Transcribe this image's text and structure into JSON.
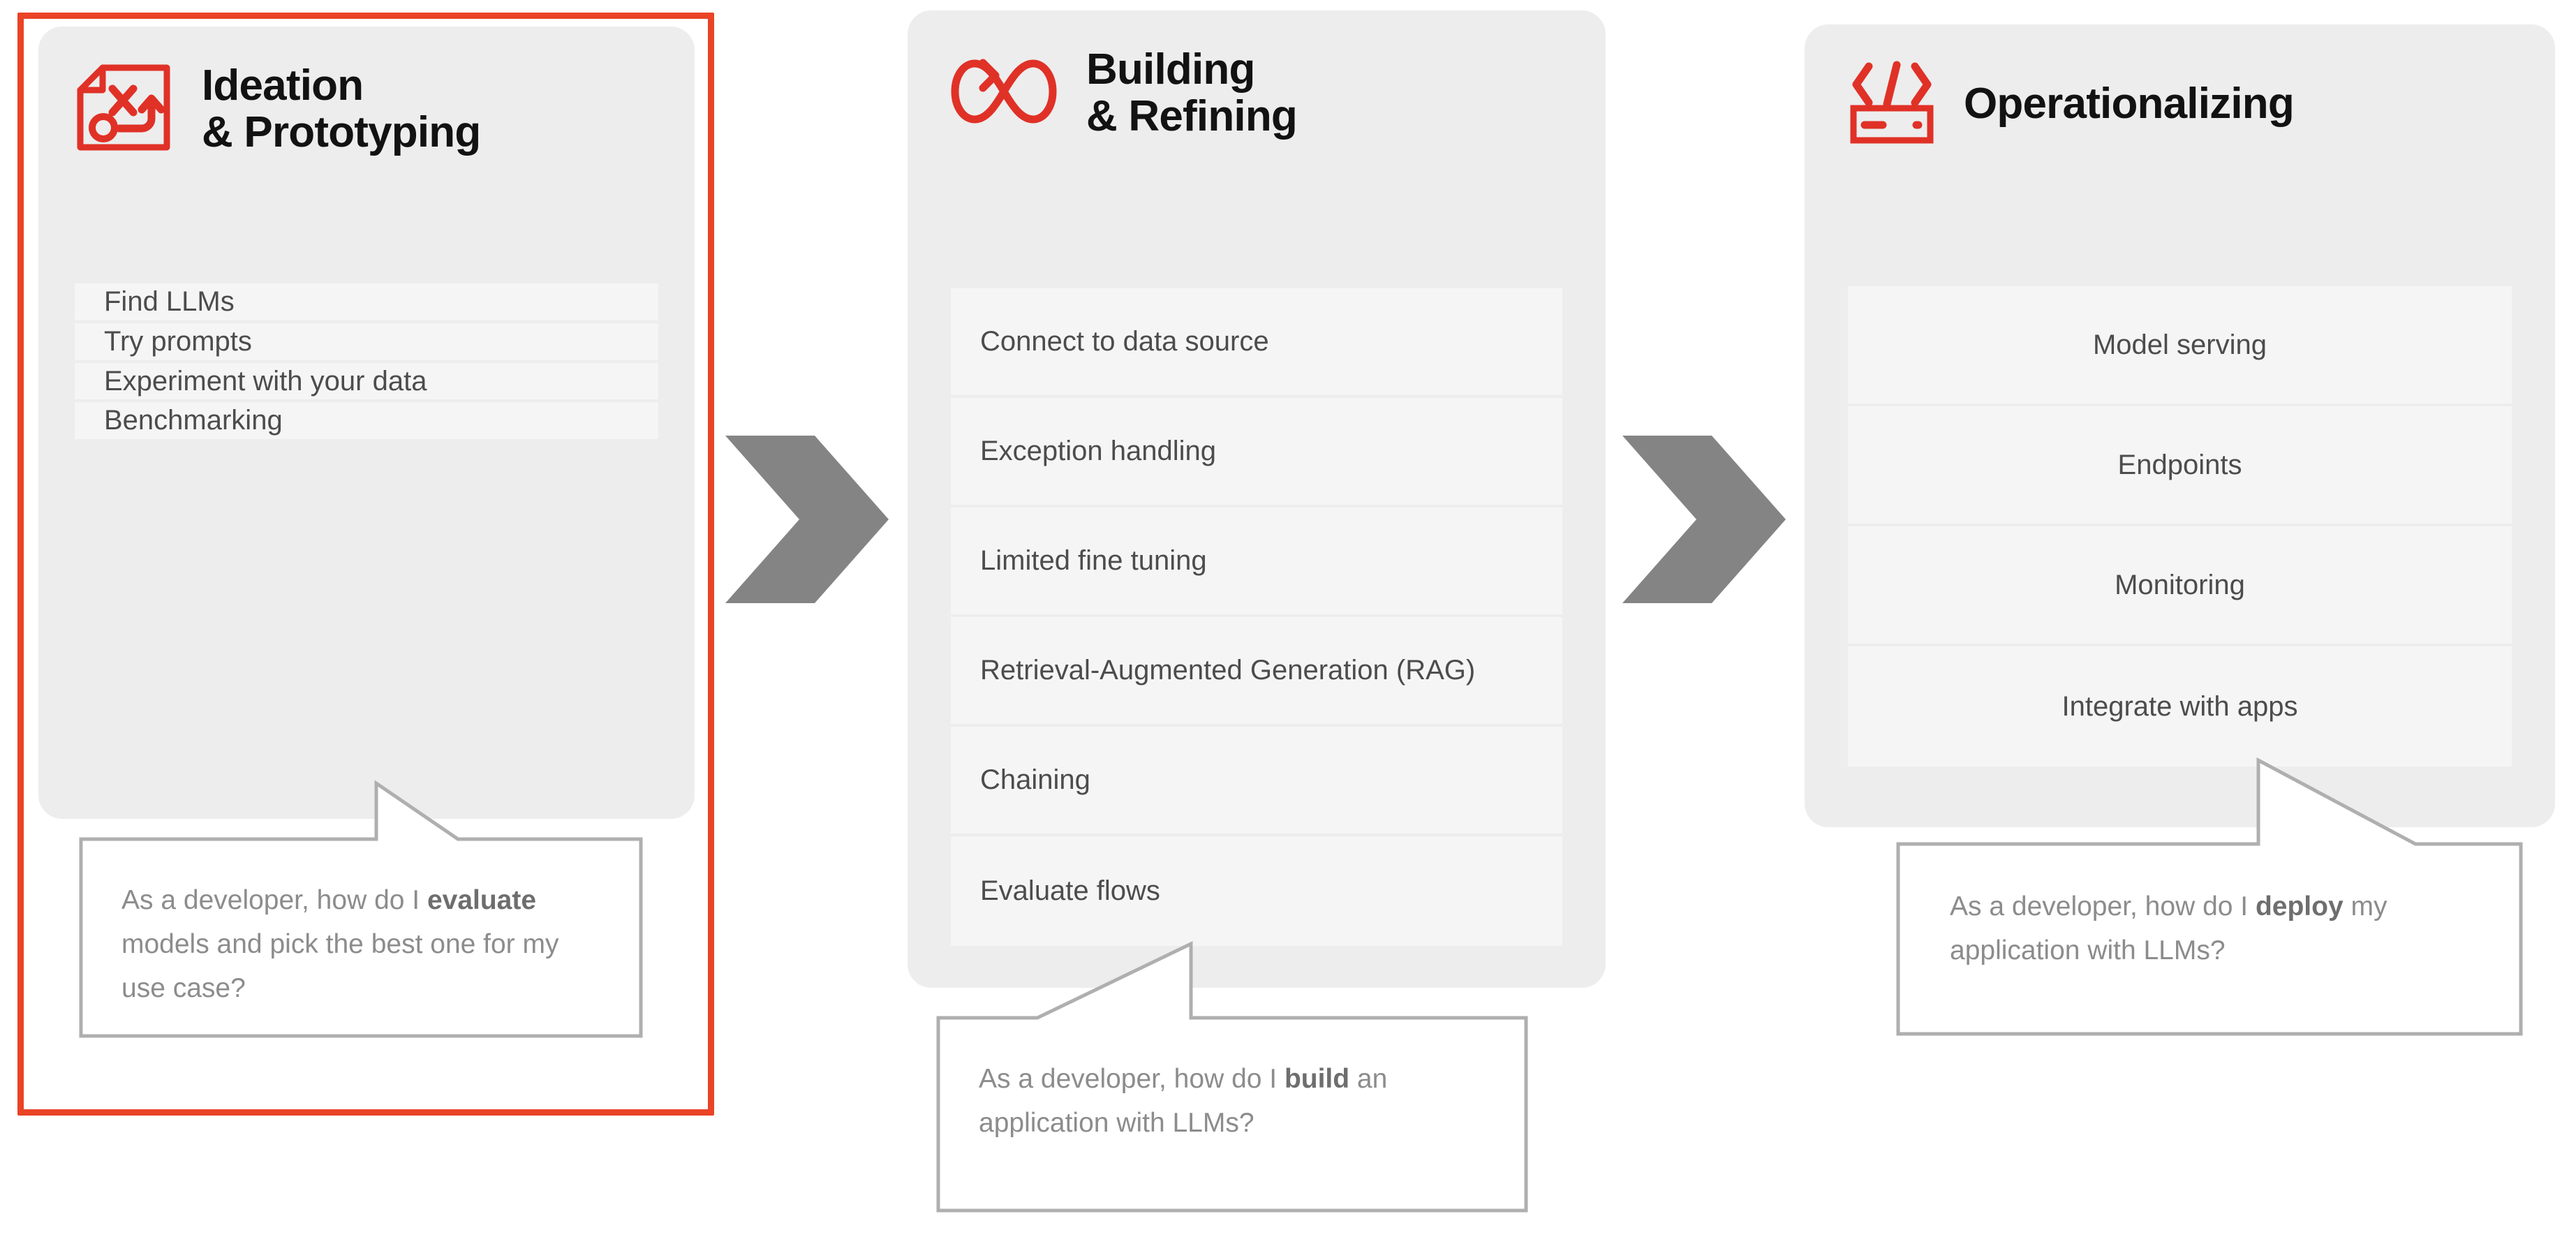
{
  "theme": {
    "accent_red": "#EA4326",
    "card_bg": "#EDEDED",
    "item_bg": "#F5F5F5",
    "item_text": "#4C4C4C",
    "callout_text": "#8C8C8C",
    "chevron_gray": "#848484",
    "title_text": "#121212"
  },
  "stages": [
    {
      "id": "ideation-prototyping",
      "title": "Ideation\n& Prototyping",
      "icon": "strategy-plan-icon",
      "highlighted": true,
      "item_align": "left",
      "items": [
        "Find LLMs",
        "Try prompts",
        "Experiment with your data",
        "Benchmarking"
      ],
      "callout": {
        "prefix": "As a developer, how do I ",
        "emphasis": "evaluate",
        "suffix": " models and pick the best one for my use case?"
      }
    },
    {
      "id": "building-refining",
      "title": "Building\n& Refining",
      "icon": "infinity-loop-arrow-icon",
      "highlighted": false,
      "item_align": "left",
      "items": [
        "Connect to data source",
        "Exception handling",
        "Limited fine tuning",
        "Retrieval-Augmented Generation (RAG)",
        "Chaining",
        "Evaluate flows"
      ],
      "callout": {
        "prefix": "As a developer, how do I ",
        "emphasis": "build",
        "suffix": " an application with LLMs?"
      }
    },
    {
      "id": "operationalizing",
      "title": "Operationalizing",
      "icon": "code-server-icon",
      "highlighted": false,
      "item_align": "center",
      "items": [
        "Model serving",
        "Endpoints",
        "Monitoring",
        "Integrate with apps"
      ],
      "callout": {
        "prefix": "As a developer, how do I ",
        "emphasis": "deploy",
        "suffix": " my application with LLMs?"
      }
    }
  ],
  "connectors": [
    {
      "name": "chevron-arrow-1",
      "direction": "right"
    },
    {
      "name": "chevron-arrow-2",
      "direction": "right"
    }
  ]
}
